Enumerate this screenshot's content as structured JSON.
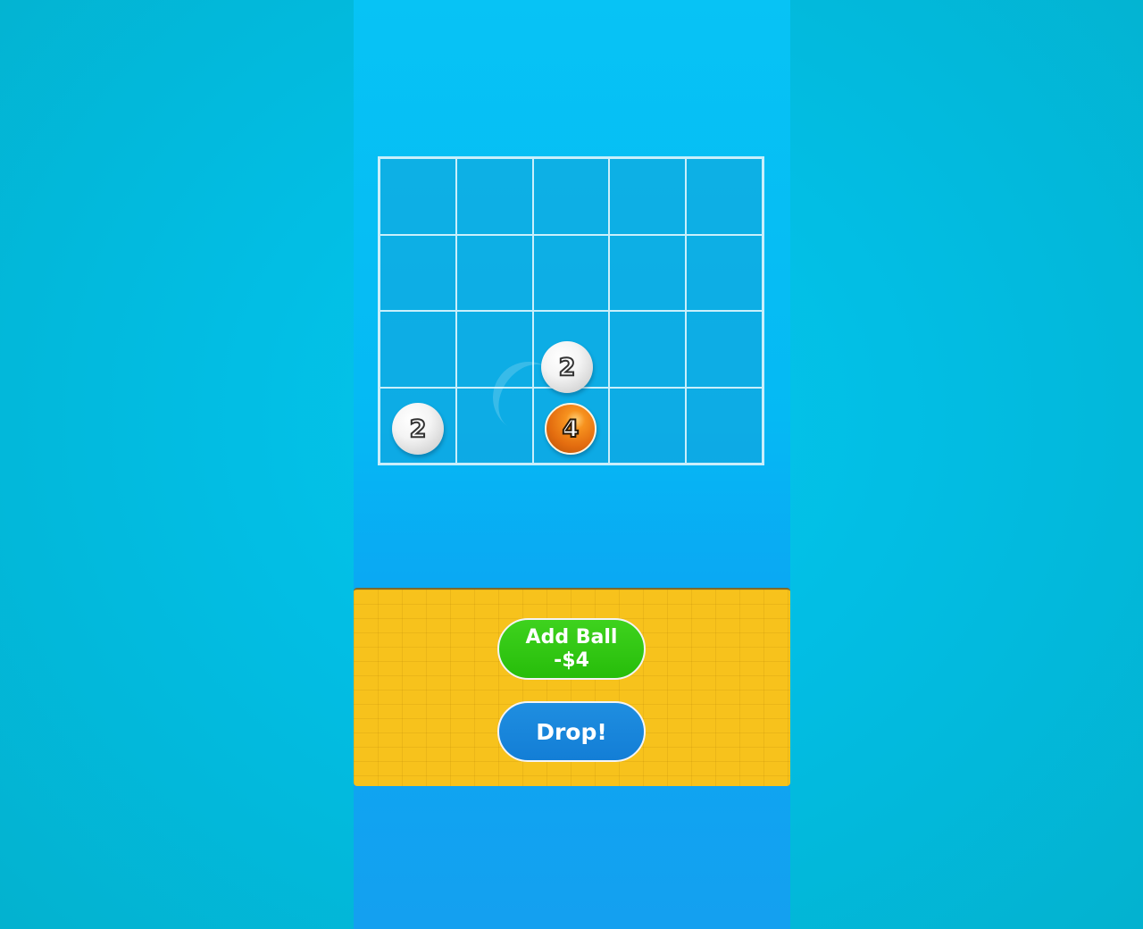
{
  "board": {
    "columns": 5,
    "rows": 4,
    "balls": [
      {
        "value": "2",
        "color": "white",
        "row": 4,
        "column": 1
      },
      {
        "value": "2",
        "color": "white",
        "row": 3,
        "column": 3
      },
      {
        "value": "4",
        "color": "orange",
        "row": 4,
        "column": 3
      }
    ]
  },
  "controls": {
    "add_ball_label": "Add Ball",
    "add_ball_cost": "-$4",
    "drop_label": "Drop!"
  },
  "colors": {
    "background": "#03bfe3",
    "playfield": "#07b9f4",
    "panel": "#f7c21c",
    "add_ball_button": "#2fc812",
    "drop_button": "#1a86db",
    "ball_white": "#f2f2f2",
    "ball_orange": "#ec7a15"
  }
}
